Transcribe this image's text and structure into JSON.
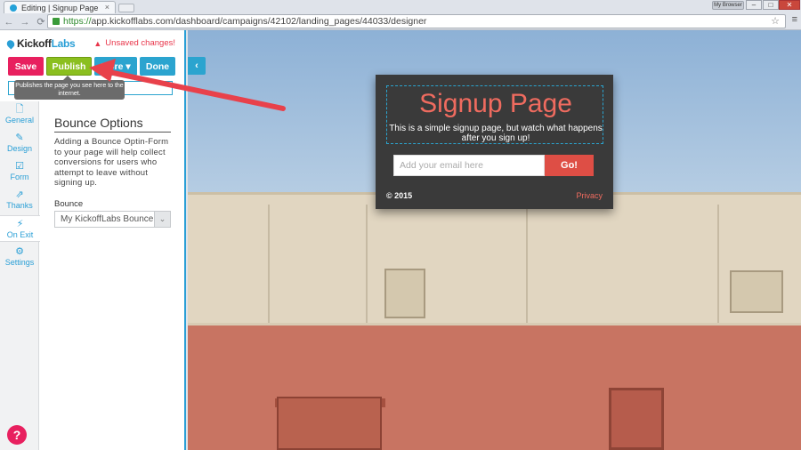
{
  "browser": {
    "tab_title": "Editing | Signup Page",
    "tab_close": "×",
    "url_https": "https://",
    "url_rest": "app.kickofflabs.com/dashboard/campaigns/42102/landing_pages/44033/designer",
    "user_label": "My Browser",
    "min": "–",
    "max": "□",
    "close": "✕",
    "back": "←",
    "forward": "→",
    "reload": "⟳",
    "star": "☆",
    "menu": "≡"
  },
  "sidebar": {
    "logo_kickoff": "Kickoff",
    "logo_labs": "Labs",
    "unsaved": "Unsaved changes!",
    "unsaved_icon": "▲",
    "buttons": {
      "save": "Save",
      "publish": "Publish",
      "more": "More ▾",
      "done": "Done"
    },
    "tooltip": "Publishes the page you see here to the internet.",
    "tabs": [
      {
        "label": "General",
        "icon": "🗋"
      },
      {
        "label": "Design",
        "icon": "✎"
      },
      {
        "label": "Form",
        "icon": "☑"
      },
      {
        "label": "Thanks",
        "icon": "⇗"
      },
      {
        "label": "On Exit",
        "icon": "⚡"
      },
      {
        "label": "Settings",
        "icon": "⚙"
      }
    ],
    "help": "?",
    "panel": {
      "title": "Bounce Options",
      "description": "Adding a Bounce Optin-Form to your page will help collect conversions for users who attempt to leave without signing up.",
      "bounce_label": "Bounce",
      "bounce_value": "My KickoffLabs Bounce...",
      "caret": "⌄"
    }
  },
  "canvas": {
    "collapse": "‹",
    "signup": {
      "title": "Signup Page",
      "subtitle": "This is a simple signup page, but watch what happens after you sign up!",
      "email_placeholder": "Add your email here",
      "go": "Go!",
      "copyright": "© 2015",
      "privacy": "Privacy"
    }
  },
  "colors": {
    "accent": "#2ba4cf",
    "save": "#e8205f",
    "publish": "#8bbf1f",
    "brand_red": "#ef6b5f"
  }
}
